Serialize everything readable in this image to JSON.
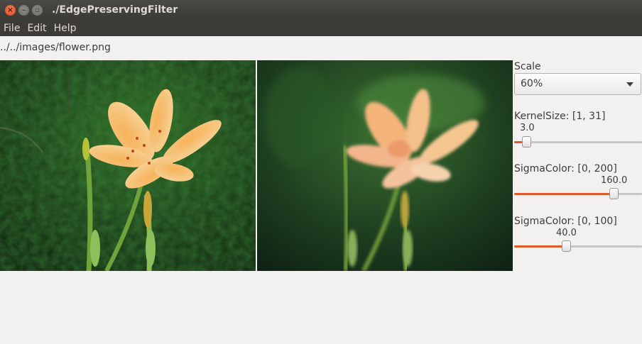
{
  "window": {
    "title": "./EdgePreservingFilter",
    "close_glyph": "×",
    "min_glyph": "–",
    "max_glyph": "▫"
  },
  "menu": [
    "File",
    "Edit",
    "Help"
  ],
  "file_path": "../../images/flower.png",
  "controls": {
    "scale": {
      "label": "Scale",
      "value": "60%"
    },
    "kernel": {
      "label": "KernelSize: [1, 31]",
      "value_text": "3.0",
      "value": 3.0,
      "min": 1,
      "max": 31
    },
    "sigma_color": {
      "label": "SigmaColor: [0, 200]",
      "value_text": "160.0",
      "value": 160.0,
      "min": 0,
      "max": 200
    },
    "sigma_space": {
      "label": "SigmaColor: [0, 100]",
      "value_text": "40.0",
      "value": 40.0,
      "min": 0,
      "max": 100
    }
  },
  "colors": {
    "accent": "#e05a2b",
    "titlebar": "#3c3b37"
  }
}
